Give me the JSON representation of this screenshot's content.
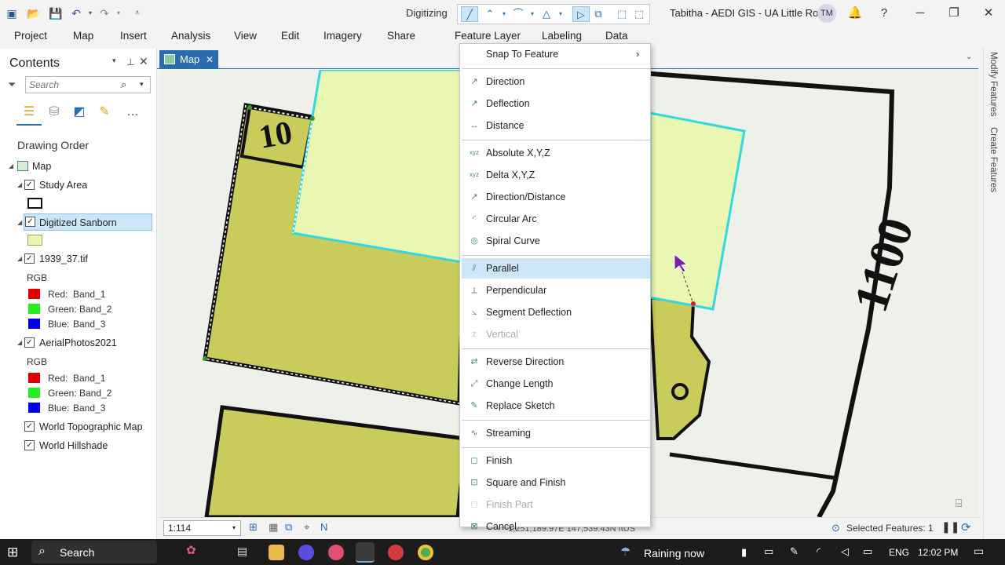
{
  "quick_access": [
    "new-project-icon",
    "open-icon",
    "save-icon",
    "undo-icon",
    "redo-icon",
    "customize-icon"
  ],
  "contextual": {
    "label": "Digitizing",
    "tools": [
      "line-icon",
      "polyline-icon",
      "arc-icon",
      "trace-icon",
      "select-icon",
      "vertices-icon",
      "clip-icon",
      "reshape-icon"
    ]
  },
  "app": {
    "title": "Tabitha - AEDI GIS - UA Little Rock",
    "initials": "TM"
  },
  "ribbon": {
    "tabs": [
      "Project",
      "Map",
      "Insert",
      "Analysis",
      "View",
      "Edit",
      "Imagery",
      "Share",
      "Feature Layer",
      "Labeling",
      "Data"
    ]
  },
  "contents": {
    "title": "Contents",
    "search_placeholder": "Search",
    "drawing_order": "Drawing Order",
    "map_label": "Map",
    "layers": [
      {
        "name": "Study Area",
        "checked": true,
        "fill": "#ffffff",
        "stroke": "#111111"
      },
      {
        "name": "Digitized Sanborn",
        "checked": true,
        "selected": true,
        "fill": "#e8f5b0",
        "stroke": "#9aa86a"
      },
      {
        "name": "1939_37.tif",
        "checked": true,
        "rgb_label": "RGB",
        "bands": [
          {
            "label": "Red:",
            "band": "Band_1",
            "color": "#e00000"
          },
          {
            "label": "Green:",
            "band": "Band_2",
            "color": "#22ee22"
          },
          {
            "label": "Blue:",
            "band": "Band_3",
            "color": "#0000ee"
          }
        ]
      },
      {
        "name": "AerialPhotos2021",
        "checked": true,
        "rgb_label": "RGB",
        "bands": [
          {
            "label": "Red:",
            "band": "Band_1",
            "color": "#e00000"
          },
          {
            "label": "Green:",
            "band": "Band_2",
            "color": "#22ee22"
          },
          {
            "label": "Blue:",
            "band": "Band_3",
            "color": "#0000ee"
          }
        ]
      },
      {
        "name": "World Topographic Map",
        "checked": true
      },
      {
        "name": "World Hillshade",
        "checked": true
      }
    ]
  },
  "map_tab": {
    "label": "Map"
  },
  "map": {
    "label_text": "1100",
    "parcel_label": "10"
  },
  "rail": [
    "Modify Features",
    "Create Features"
  ],
  "status": {
    "scale": "1:114",
    "coords": "1,251,189.97E 147,539.43N ftUS",
    "selected": "Selected Features: 1"
  },
  "menu": {
    "items": [
      {
        "label": "Snap To Feature",
        "icon": "snap-icon",
        "submenu": true
      },
      {
        "sep": true
      },
      {
        "label": "Direction",
        "icon": "direction-icon"
      },
      {
        "label": "Deflection",
        "icon": "deflection-icon"
      },
      {
        "label": "Distance",
        "icon": "distance-icon"
      },
      {
        "sep": true
      },
      {
        "label": "Absolute X,Y,Z",
        "icon": "xyz-icon"
      },
      {
        "label": "Delta X,Y,Z",
        "icon": "delta-xyz-icon"
      },
      {
        "label": "Direction/Distance",
        "icon": "direction-distance-icon"
      },
      {
        "label": "Circular Arc",
        "icon": "circular-arc-icon"
      },
      {
        "label": "Spiral Curve",
        "icon": "spiral-icon"
      },
      {
        "sep": true
      },
      {
        "label": "Parallel",
        "icon": "parallel-icon",
        "highlight": true
      },
      {
        "label": "Perpendicular",
        "icon": "perpendicular-icon"
      },
      {
        "label": "Segment Deflection",
        "icon": "segment-deflection-icon"
      },
      {
        "label": "Vertical",
        "icon": "vertical-icon",
        "disabled": true
      },
      {
        "sep": true
      },
      {
        "label": "Reverse Direction",
        "icon": "reverse-icon"
      },
      {
        "label": "Change Length",
        "icon": "change-length-icon"
      },
      {
        "label": "Replace Sketch",
        "icon": "replace-sketch-icon"
      },
      {
        "sep": true
      },
      {
        "label": "Streaming",
        "icon": "streaming-icon"
      },
      {
        "sep": true
      },
      {
        "label": "Finish",
        "icon": "finish-icon"
      },
      {
        "label": "Square and Finish",
        "icon": "square-finish-icon"
      },
      {
        "label": "Finish Part",
        "icon": "finish-part-icon",
        "disabled": true
      },
      {
        "label": "Cancel",
        "icon": "cancel-icon"
      }
    ]
  },
  "taskbar": {
    "search": "Search",
    "weather": "Raining now",
    "lang": "ENG",
    "time": "12:02 PM"
  }
}
